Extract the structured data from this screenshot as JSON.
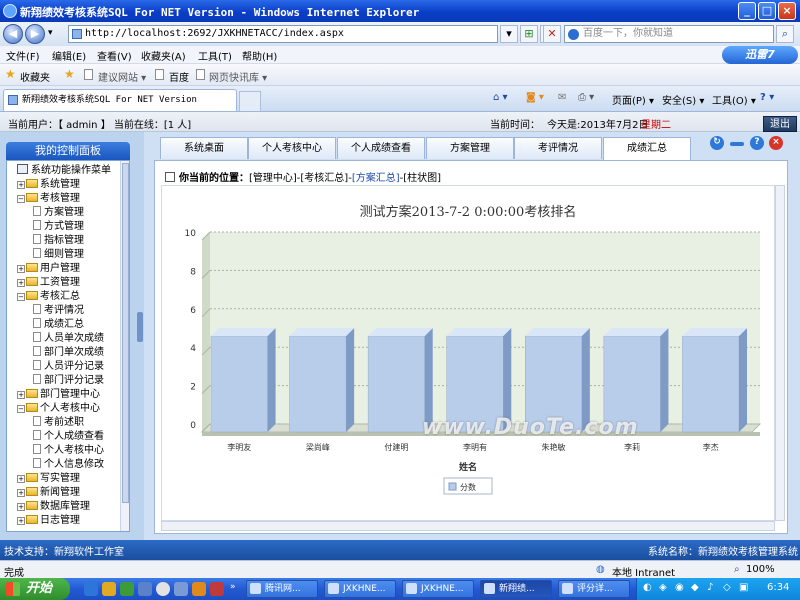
{
  "window": {
    "title": "新翔绩效考核系统SQL For NET Version - Windows Internet Explorer"
  },
  "browser": {
    "address": "http://localhost:2692/JXKHNETACC/index.aspx",
    "search_placeholder": "百度一下，你就知道",
    "menus": [
      "文件(F)",
      "编辑(E)",
      "查看(V)",
      "收藏夹(A)",
      "工具(T)",
      "帮助(H)"
    ],
    "xunlei_label": "迅雷7",
    "favorites_label": "收藏夹",
    "favorites_items": [
      "建议网站 ▾",
      "百度",
      "网页快讯库 ▾"
    ],
    "tab_title": "新翔绩效考核系统SQL For NET Version",
    "toolbar_items": [
      "页面(P) ▾",
      "安全(S) ▾",
      "工具(O) ▾"
    ]
  },
  "userbar": {
    "current_user": "当前用户：【 admin 】 当前在线：[1 人]",
    "time_label": "当前时间：",
    "today": "今天是:2013年7月2日",
    "weekday": "星期二",
    "exit_label": "退出"
  },
  "sidebar": {
    "header": "我的控制面板",
    "root": "系统功能操作菜单",
    "items": [
      {
        "label": "系统管理",
        "level": 1,
        "kind": "folder",
        "expanded": false
      },
      {
        "label": "考核管理",
        "level": 1,
        "kind": "folder",
        "expanded": true
      },
      {
        "label": "方案管理",
        "level": 2,
        "kind": "doc"
      },
      {
        "label": "方式管理",
        "level": 2,
        "kind": "doc"
      },
      {
        "label": "指标管理",
        "level": 2,
        "kind": "doc"
      },
      {
        "label": "细则管理",
        "level": 2,
        "kind": "doc"
      },
      {
        "label": "用户管理",
        "level": 1,
        "kind": "folder",
        "expanded": false
      },
      {
        "label": "工资管理",
        "level": 1,
        "kind": "folder",
        "expanded": false
      },
      {
        "label": "考核汇总",
        "level": 1,
        "kind": "folder",
        "expanded": true
      },
      {
        "label": "考评情况",
        "level": 2,
        "kind": "doc"
      },
      {
        "label": "成绩汇总",
        "level": 2,
        "kind": "doc"
      },
      {
        "label": "人员单次成绩",
        "level": 2,
        "kind": "doc"
      },
      {
        "label": "部门单次成绩",
        "level": 2,
        "kind": "doc"
      },
      {
        "label": "人员评分记录",
        "level": 2,
        "kind": "doc"
      },
      {
        "label": "部门评分记录",
        "level": 2,
        "kind": "doc"
      },
      {
        "label": "部门管理中心",
        "level": 1,
        "kind": "folder",
        "expanded": false
      },
      {
        "label": "个人考核中心",
        "level": 1,
        "kind": "folder",
        "expanded": true
      },
      {
        "label": "考前述职",
        "level": 2,
        "kind": "doc"
      },
      {
        "label": "个人成绩查看",
        "level": 2,
        "kind": "doc"
      },
      {
        "label": "个人考核中心",
        "level": 2,
        "kind": "doc"
      },
      {
        "label": "个人信息修改",
        "level": 2,
        "kind": "doc"
      },
      {
        "label": "写实管理",
        "level": 1,
        "kind": "folder",
        "expanded": false
      },
      {
        "label": "新闻管理",
        "level": 1,
        "kind": "folder",
        "expanded": false
      },
      {
        "label": "数据库管理",
        "level": 1,
        "kind": "folder",
        "expanded": false
      },
      {
        "label": "日志管理",
        "level": 1,
        "kind": "folder",
        "expanded": false
      }
    ]
  },
  "nav_tabs": [
    "系统桌面",
    "个人考核中心",
    "个人成绩查看",
    "方案管理",
    "考评情况",
    "成绩汇总"
  ],
  "active_tab": 5,
  "breadcrumb": {
    "prefix": "你当前的位置：",
    "path1": "[管理中心]-[考核汇总]-",
    "path2": "[方案汇总]",
    "path3": "-[柱状图]"
  },
  "chart_data": {
    "type": "bar",
    "title": "测试方案2013-7-2 0:00:00考核排名",
    "xlabel": "姓名",
    "ylabel": "",
    "categories": [
      "李明友",
      "梁尚峰",
      "付建明",
      "李明有",
      "朱艳敏",
      "李莉",
      "李杰"
    ],
    "series": [
      {
        "name": "分数",
        "values": [
          5,
          5,
          5,
          5,
          5,
          5,
          5
        ]
      }
    ],
    "ylim": [
      0,
      10
    ],
    "yticks": [
      0,
      2,
      4,
      6,
      8,
      10
    ],
    "grid": true,
    "legend": "bottom-center",
    "style": "3d"
  },
  "watermark": "www.DuoTe.com",
  "footer": {
    "support": "技术支持：新翔软件工作室",
    "name": "系统名称：新翔绩效考核管理系统"
  },
  "status": {
    "left": "完成",
    "zone": "本地 Intranet",
    "zoom": "100%"
  },
  "taskbar": {
    "start": "开始",
    "tasks": [
      "腾讯网...",
      "JXKHNE...",
      "JXKHNE...",
      "新翔绩...",
      "评分详..."
    ],
    "active_task": 3,
    "clock": "6:34"
  },
  "colors": {
    "bar_face": "#b8cdea",
    "bar_side": "#7e9bc5",
    "bar_top": "#d9e6f7",
    "plot_bg": "#e8efe3",
    "weekday_red": "#cc0000",
    "accent_blue": "#2459d4"
  }
}
